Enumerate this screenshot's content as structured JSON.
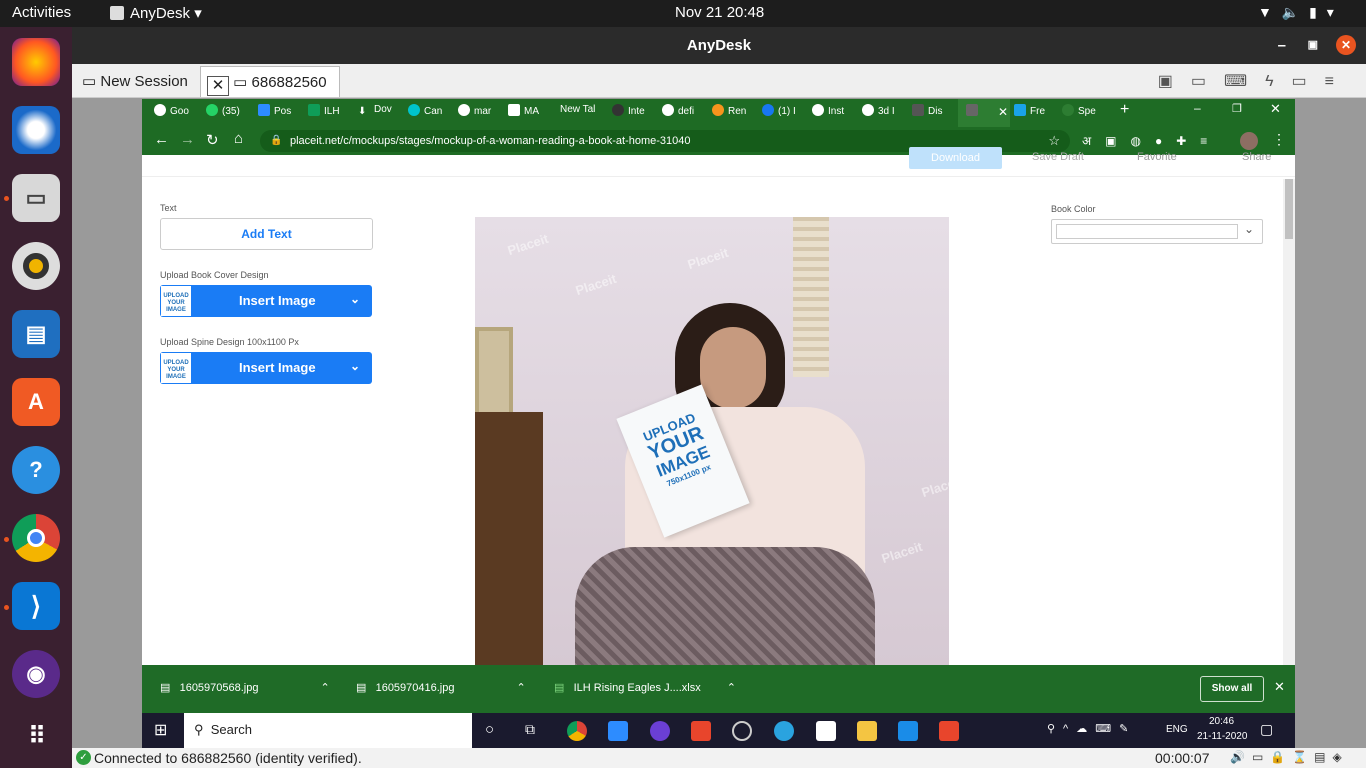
{
  "ubuntu_bar": {
    "activities": "Activities",
    "app_name": "AnyDesk",
    "datetime": "Nov 21  20:48"
  },
  "anydesk": {
    "window_title": "AnyDesk",
    "new_session": "New Session",
    "session_id": "686882560",
    "status": "Connected to 686882560 (identity verified).",
    "timer": "00:00:07"
  },
  "chrome": {
    "tabs": [
      "Goo",
      "(35)",
      "Pos",
      "ILH",
      "Dov",
      "Can",
      "mar",
      "MA",
      "New Tal",
      "Inte",
      "defi",
      "Ren",
      "(1) I",
      "Inst",
      "3d I",
      "Dis",
      "",
      "Fre",
      "Spe"
    ],
    "url": "placeit.net/c/mockups/stages/mockup-of-a-woman-reading-a-book-at-home-31040"
  },
  "placeit": {
    "top_buttons": [
      "Download",
      "Save Draft",
      "Favorite",
      "Share"
    ],
    "text_label": "Text",
    "add_text": "Add Text",
    "cover_label": "Upload Book Cover Design",
    "spine_label": "Upload Spine Design 100x1100 Px",
    "insert_image": "Insert Image",
    "thumb_text": "UPLOAD YOUR IMAGE",
    "book_color_label": "Book Color",
    "book_upload": "UPLOAD",
    "book_your": "YOUR",
    "book_image": "IMAGE",
    "book_size": "750x1100 px",
    "watermark": "Placeit"
  },
  "downloads": {
    "items": [
      "1605970568.jpg",
      "1605970416.jpg",
      "ILH Rising Eagles J....xlsx"
    ],
    "show_all": "Show all"
  },
  "windows": {
    "search": "Search",
    "lang": "ENG",
    "time": "20:46",
    "date": "21-11-2020"
  },
  "colors": {
    "chrome_green": "#1e6b24",
    "insert_blue": "#1a7cf5",
    "ubuntu_orange": "#e95420"
  }
}
